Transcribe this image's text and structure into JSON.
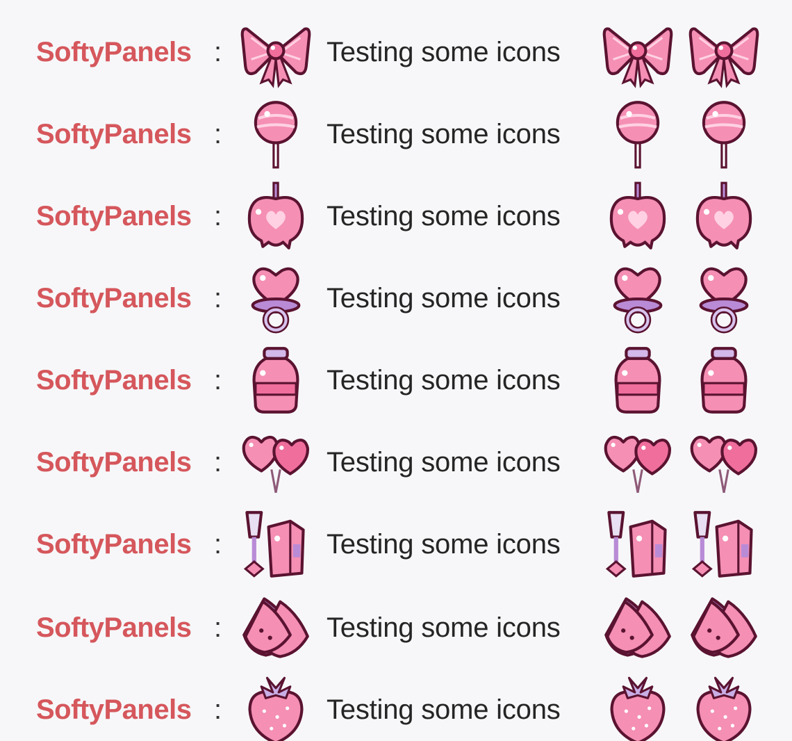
{
  "chat": {
    "messages": [
      {
        "username": "SoftyPanels",
        "separator": ":",
        "text": "Testing some icons",
        "emote": "bow-icon"
      },
      {
        "username": "SoftyPanels",
        "separator": ":",
        "text": "Testing some icons",
        "emote": "lollipop-icon"
      },
      {
        "username": "SoftyPanels",
        "separator": ":",
        "text": "Testing some icons",
        "emote": "candy-apple-icon"
      },
      {
        "username": "SoftyPanels",
        "separator": ":",
        "text": "Testing some icons",
        "emote": "pacifier-icon"
      },
      {
        "username": "SoftyPanels",
        "separator": ":",
        "text": "Testing some icons",
        "emote": "milk-bottle-icon"
      },
      {
        "username": "SoftyPanels",
        "separator": ":",
        "text": "Testing some icons",
        "emote": "heart-balloons-icon"
      },
      {
        "username": "SoftyPanels",
        "separator": ":",
        "text": "Testing some icons",
        "emote": "juice-box-icon"
      },
      {
        "username": "SoftyPanels",
        "separator": ":",
        "text": "Testing some icons",
        "emote": "watermelon-icon"
      },
      {
        "username": "SoftyPanels",
        "separator": ":",
        "text": "Testing some icons",
        "emote": "strawberry-icon"
      }
    ]
  },
  "colors": {
    "username": "#d5575c",
    "message": "#252525",
    "background": "#f7f7f9",
    "emote_pink": "#f58fb4",
    "emote_light": "#ffd1e2",
    "emote_outline": "#5a1330",
    "emote_purple": "#b98bd6"
  }
}
